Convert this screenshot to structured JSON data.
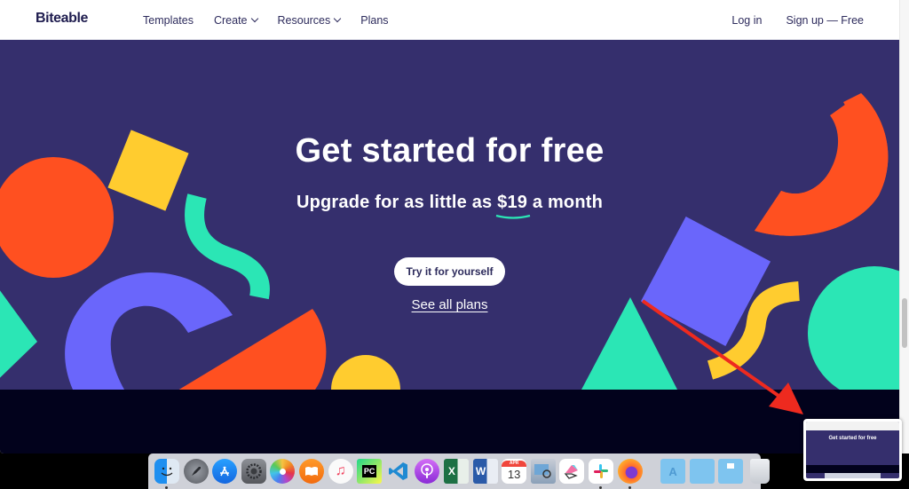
{
  "header": {
    "logo": "Biteable",
    "nav": [
      {
        "label": "Templates",
        "has_dropdown": false
      },
      {
        "label": "Create",
        "has_dropdown": true
      },
      {
        "label": "Resources",
        "has_dropdown": true
      },
      {
        "label": "Plans",
        "has_dropdown": false
      }
    ],
    "login_label": "Log in",
    "signup_label": "Sign up — Free"
  },
  "hero": {
    "title": "Get started for free",
    "subtitle_before": "Upgrade for as little as ",
    "price": "$19",
    "subtitle_after": " a month",
    "cta_label": "Try it for yourself",
    "plans_link_label": "See all plans"
  },
  "colors": {
    "hero_bg": "#352f6d",
    "orange": "#ff5020",
    "yellow": "#ffcc2f",
    "teal": "#2be6b5",
    "violet": "#6a66fb",
    "band_dark": "#02021c",
    "text_nav": "#2d2b5c",
    "annotation_arrow": "#ee2a1f"
  },
  "thumbnail": {
    "title": "Get started for free"
  },
  "dock": {
    "apps": [
      {
        "name": "Finder",
        "icon": "finder-icon",
        "running": true
      },
      {
        "name": "Launchpad",
        "icon": "launchpad-icon",
        "running": false
      },
      {
        "name": "App Store",
        "icon": "app-store-icon",
        "running": false
      },
      {
        "name": "System Preferences",
        "icon": "system-preferences-icon",
        "running": false
      },
      {
        "name": "Photos",
        "icon": "photos-icon",
        "running": false
      },
      {
        "name": "Books",
        "icon": "books-icon",
        "running": false
      },
      {
        "name": "Music",
        "icon": "music-icon",
        "running": false
      },
      {
        "name": "PyCharm",
        "icon": "pycharm-icon",
        "running": false
      },
      {
        "name": "Visual Studio Code",
        "icon": "vscode-icon",
        "running": false
      },
      {
        "name": "Podcasts",
        "icon": "podcasts-icon",
        "running": false
      },
      {
        "name": "Excel",
        "icon": "excel-icon",
        "running": false
      },
      {
        "name": "Word",
        "icon": "word-icon",
        "running": false
      },
      {
        "name": "Calendar",
        "icon": "calendar-icon",
        "running": false,
        "badge_text": "13",
        "month": "APR"
      },
      {
        "name": "Preview",
        "icon": "preview-icon",
        "running": false
      },
      {
        "name": "Klokki",
        "icon": "pen-app-icon",
        "running": false
      },
      {
        "name": "Slack",
        "icon": "slack-icon",
        "running": true
      },
      {
        "name": "Firefox",
        "icon": "firefox-icon",
        "running": true
      }
    ],
    "folders": [
      {
        "name": "Applications",
        "icon": "applications-folder-icon"
      },
      {
        "name": "Documents",
        "icon": "documents-folder-icon"
      },
      {
        "name": "Downloads",
        "icon": "downloads-folder-icon"
      },
      {
        "name": "Trash",
        "icon": "trash-icon"
      }
    ]
  }
}
